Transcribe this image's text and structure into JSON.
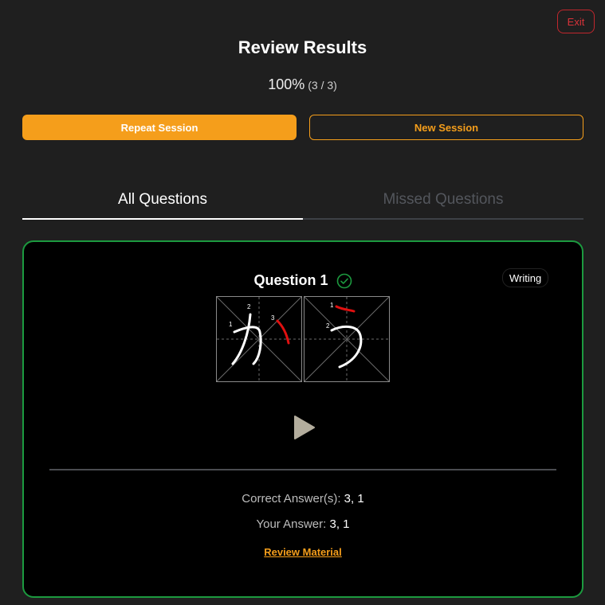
{
  "header": {
    "exit_label": "Exit",
    "title": "Review Results",
    "score_percent": "100%",
    "score_fraction": "(3 / 3)"
  },
  "actions": {
    "repeat_label": "Repeat Session",
    "new_label": "New Session"
  },
  "tabs": [
    {
      "label": "All Questions",
      "active": true
    },
    {
      "label": "Missed Questions",
      "active": false
    }
  ],
  "question": {
    "title": "Question 1",
    "status": "correct",
    "type_badge": "Writing",
    "kana": [
      "か",
      "う"
    ],
    "stroke_numbers": [
      [
        "1",
        "2",
        "3"
      ],
      [
        "1",
        "2"
      ]
    ],
    "correct_label": "Correct Answer(s):",
    "correct_value": "3, 1",
    "your_label": "Your Answer:",
    "your_value": "3, 1",
    "review_link": "Review Material"
  },
  "colors": {
    "accent": "#f59e1b",
    "success": "#1c9a3f",
    "danger": "#c1272d",
    "stroke_highlight": "#e01010"
  }
}
